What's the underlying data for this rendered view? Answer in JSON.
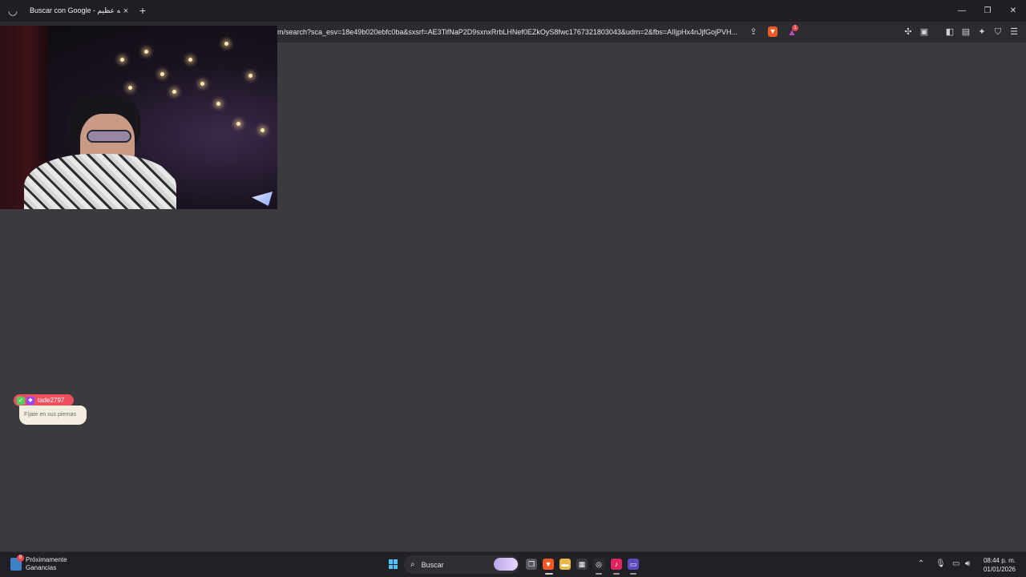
{
  "browser": {
    "tab": {
      "title": "Buscar con Google - الله عظيم",
      "close_icon": "×"
    },
    "new_tab_icon": "+",
    "window_controls": {
      "minimize": "—",
      "maximize": "❐",
      "close": "✕"
    },
    "url": "m/search?sca_esv=18e49b020ebfc0ba&sxsrf=AE3TifNaP2D9sxnxRrbLHNef0EZkOyS8fwc1767321803043&udm=2&fbs=AIIjpHx4nJjfGojPVH...",
    "rewards_badge": "1"
  },
  "chat": {
    "username": "tade2797",
    "message": "Fíjate en sus piernas"
  },
  "taskbar": {
    "widget": {
      "title": "Próximamente",
      "subtitle": "Ganancias",
      "badge": "9"
    },
    "search_label": "Buscar",
    "clock": {
      "time": "08:44 p. m.",
      "date": "01/01/2026"
    }
  },
  "colors": {
    "page_background": "#3a3a3f",
    "tabstrip": "#1f1f23",
    "toolbar": "#2b2b30",
    "taskbar": "#202026",
    "chat_name_pill": "#f0505e",
    "chat_message": "#f3eedf"
  }
}
